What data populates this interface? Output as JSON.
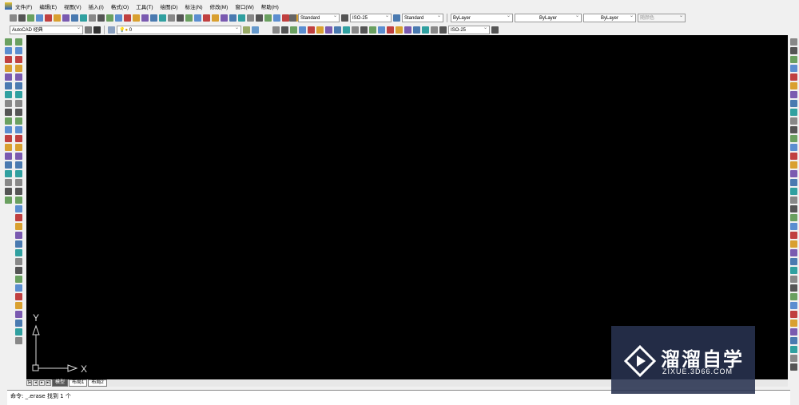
{
  "menu": [
    "文件(F)",
    "编辑(E)",
    "视图(V)",
    "插入(I)",
    "格式(O)",
    "工具(T)",
    "绘图(D)",
    "标注(N)",
    "修改(M)",
    "窗口(W)",
    "帮助(H)"
  ],
  "toolbar": {
    "text_style": "Standard",
    "dim_style": "ISO-25",
    "table_style": "Standard",
    "color": "ByLayer",
    "linetype": "ByLayer",
    "lineweight": "ByLayer",
    "plot_style": "随颜色",
    "workspace": "AutoCAD 经典",
    "layer": "0",
    "dim_style2": "ISO-25"
  },
  "ucs": {
    "x": "X",
    "y": "Y"
  },
  "tabs": [
    "模型",
    "布局1",
    "布局2"
  ],
  "command": {
    "line": "命令: _.erase 找到 1 个"
  },
  "watermark": {
    "name": "溜溜自学",
    "url": "ZIXUE.3D66.COM"
  },
  "colors": {
    "canvas": "#000000",
    "watermark_bg": "#283250"
  }
}
